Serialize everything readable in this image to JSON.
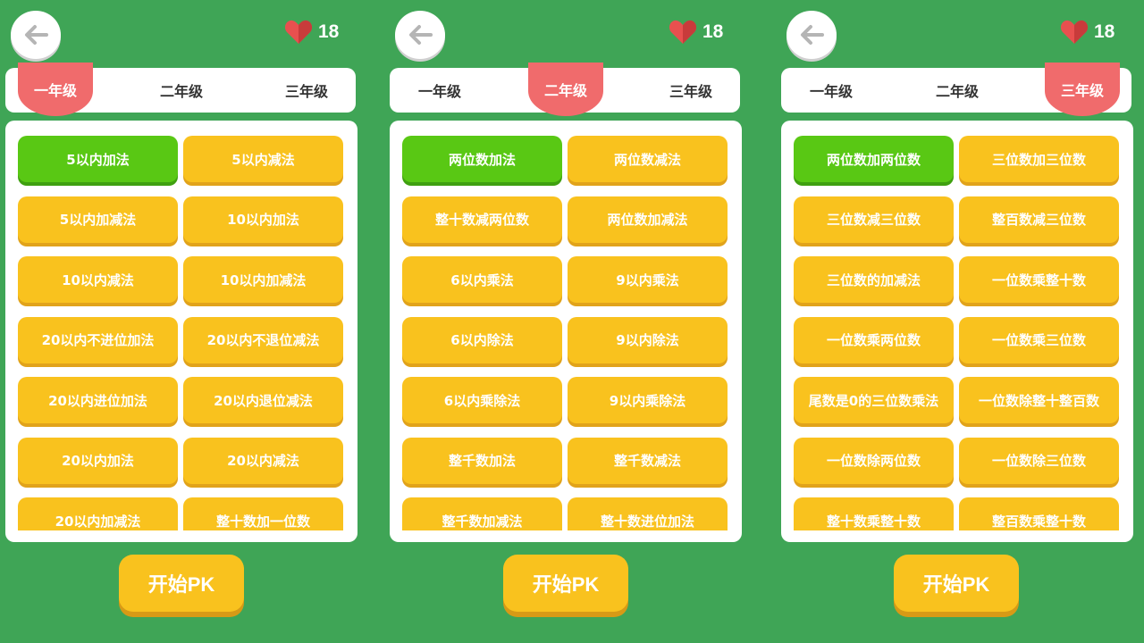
{
  "colors": {
    "background": "#3fa556",
    "tab_active": "#f06b6c",
    "item": "#f9c21e",
    "item_selected": "#59c814",
    "heart": "#e8504f"
  },
  "icons": {
    "back": "arrow-left-icon",
    "heart": "heart-icon"
  },
  "panels": [
    {
      "hearts": "18",
      "tabs": [
        "一年级",
        "二年级",
        "三年级"
      ],
      "active_tab": 0,
      "selected_item": 0,
      "items": [
        "5以内加法",
        "5以内减法",
        "5以内加减法",
        "10以内加法",
        "10以内减法",
        "10以内加减法",
        "20以内不进位加法",
        "20以内不退位减法",
        "20以内进位加法",
        "20以内退位减法",
        "20以内加法",
        "20以内减法",
        "20以内加减法",
        "整十数加一位数"
      ],
      "start_label": "开始PK"
    },
    {
      "hearts": "18",
      "tabs": [
        "一年级",
        "二年级",
        "三年级"
      ],
      "active_tab": 1,
      "selected_item": 0,
      "items": [
        "两位数加法",
        "两位数减法",
        "整十数减两位数",
        "两位数加减法",
        "6以内乘法",
        "9以内乘法",
        "6以内除法",
        "9以内除法",
        "6以内乘除法",
        "9以内乘除法",
        "整千数加法",
        "整千数减法",
        "整千数加减法",
        "整十数进位加法"
      ],
      "start_label": "开始PK"
    },
    {
      "hearts": "18",
      "tabs": [
        "一年级",
        "二年级",
        "三年级"
      ],
      "active_tab": 2,
      "selected_item": 0,
      "items": [
        "两位数加两位数",
        "三位数加三位数",
        "三位数减三位数",
        "整百数减三位数",
        "三位数的加减法",
        "一位数乘整十数",
        "一位数乘两位数",
        "一位数乘三位数",
        "尾数是0的三位数乘法",
        "一位数除整十整百数",
        "一位数除两位数",
        "一位数除三位数",
        "整十数乘整十数",
        "整百数乘整十数"
      ],
      "start_label": "开始PK"
    }
  ]
}
